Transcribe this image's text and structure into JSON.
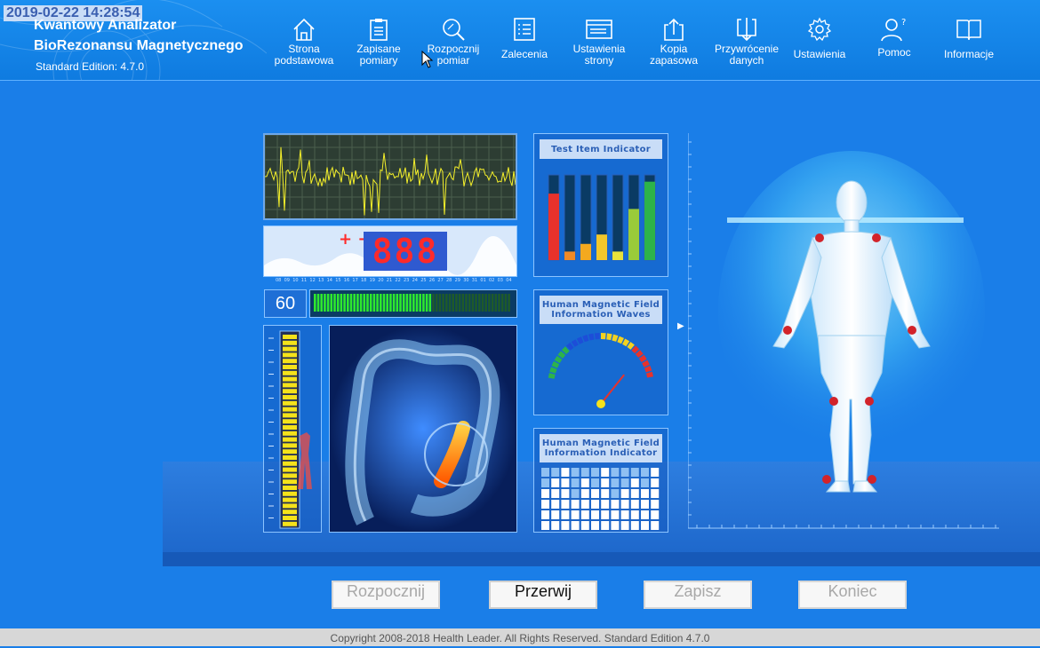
{
  "timestamp": "2019-02-22  14:28:54",
  "app": {
    "title_line1": "Kwantowy Analizator",
    "title_line2": "BioRezonansu Magnetycznego",
    "edition": "Standard Edition: 4.7.0"
  },
  "nav": [
    {
      "id": "home",
      "line1": "Strona",
      "line2": "podstawowa",
      "icon": "home-icon"
    },
    {
      "id": "saved",
      "line1": "Zapisane",
      "line2": "pomiary",
      "icon": "clipboard-icon"
    },
    {
      "id": "start-measure",
      "line1": "Rozpocznij",
      "line2": "pomiar",
      "icon": "magnifier-icon"
    },
    {
      "id": "recommendations",
      "line1": "Zalecenia",
      "line2": "",
      "icon": "list-icon"
    },
    {
      "id": "page-settings",
      "line1": "Ustawienia",
      "line2": "strony",
      "icon": "browser-window-icon"
    },
    {
      "id": "backup",
      "line1": "Kopia",
      "line2": "zapasowa",
      "icon": "upload-icon"
    },
    {
      "id": "restore",
      "line1": "Przywrócenie",
      "line2": "danych",
      "icon": "download-icon"
    },
    {
      "id": "settings",
      "line1": "Ustawienia",
      "line2": "",
      "icon": "gear-icon"
    },
    {
      "id": "help",
      "line1": "Pomoc",
      "line2": "",
      "icon": "user-help-icon"
    },
    {
      "id": "info",
      "line1": "Informacje",
      "line2": "",
      "icon": "book-icon"
    }
  ],
  "counter": {
    "sign": "+ −",
    "digits": "888"
  },
  "time_ticks": [
    "08",
    "09",
    "10",
    "11",
    "12",
    "13",
    "14",
    "15",
    "16",
    "17",
    "18",
    "19",
    "20",
    "21",
    "22",
    "23",
    "24",
    "25",
    "26",
    "27",
    "28",
    "29",
    "30",
    "31",
    "01",
    "02",
    "03",
    "04"
  ],
  "speed": "60",
  "progress_fraction": 0.6,
  "vertical_level_fraction": 1.0,
  "panels": {
    "test_item": "Test Item Indicator",
    "waves": "Human Magnetic Field Information Waves",
    "info": "Human Magnetic Field Information Indicator"
  },
  "test_item_levels": [
    0.78,
    0.1,
    0.19,
    0.3,
    0.1,
    0.6,
    0.92
  ],
  "test_item_colors": [
    "#e8322b",
    "#f08a26",
    "#f4a91f",
    "#f2c72b",
    "#e8e23a",
    "#9acb3a",
    "#2db34a"
  ],
  "gauge_value_fraction": 0.72,
  "buttons": {
    "start": "Rozpocznij",
    "stop": "Przerwij",
    "save": "Zapisz",
    "end": "Koniec"
  },
  "footer": "Copyright 2008-2018 Health Leader. All Rights Reserved.  Standard Edition 4.7.0",
  "colors": {
    "accent": "#1a7ee8",
    "header": "#1b8ff0",
    "digit": "#ff2a2a"
  }
}
